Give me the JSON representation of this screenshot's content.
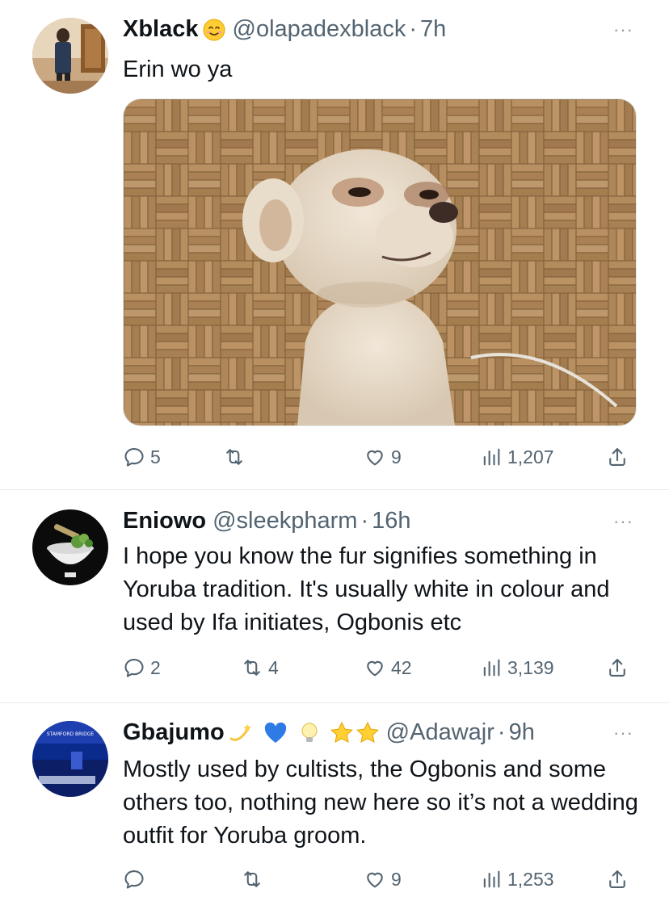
{
  "tweets": [
    {
      "name": "Xblack",
      "handle": "@olapadexblack",
      "dot": "·",
      "time": "7h",
      "text": "Erin wo ya",
      "more": "···",
      "media_icon": "dog-photo",
      "counts": {
        "replies": "5",
        "retweets": "",
        "likes": "9",
        "views": "1,207"
      }
    },
    {
      "name": "Eniowo",
      "handle": "@sleekpharm",
      "dot": "·",
      "time": "16h",
      "text": "I hope you know the fur signifies something in Yoruba tradition. It's usually white in colour and used by Ifa initiates, Ogbonis etc",
      "more": "···",
      "counts": {
        "replies": "2",
        "retweets": "4",
        "likes": "42",
        "views": "3,139"
      }
    },
    {
      "name": "Gbajumo",
      "handle": "@Adawajr",
      "dot": "·",
      "time": "9h",
      "text": "Mostly used by cultists, the Ogbonis and some others too, nothing new here so it’s not a wedding outfit for Yoruba groom.",
      "more": "···",
      "avatar_label": "STAMFORD BRIDGE",
      "counts": {
        "replies": "",
        "retweets": "",
        "likes": "9",
        "views": "1,253"
      }
    }
  ],
  "colors": {
    "text": "#0f1419",
    "muted": "#536471",
    "divider": "#e6ecf0"
  },
  "icons": [
    "reply-icon",
    "retweet-icon",
    "like-icon",
    "views-icon",
    "share-icon",
    "more-icon"
  ]
}
